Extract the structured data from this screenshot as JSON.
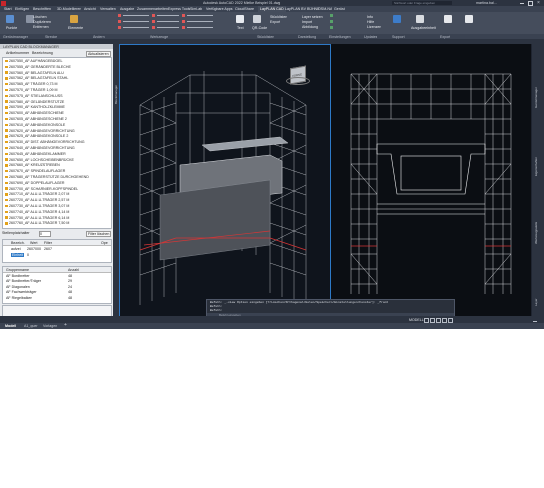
{
  "titlebar": {
    "title": "Autodesk AutoCAD 2022   Mielke Beispiel 01.dwg",
    "search_placeholder": "Stichwort oder Frage eingeben",
    "user": "martina.bal..."
  },
  "menubar": {
    "items": [
      "Start",
      "Einfügen",
      "Beschriften",
      "3D-Modellieren",
      "Ansicht",
      "Verwalten",
      "Ausgabe",
      "Zusammenarbeiten",
      "Express Tools",
      "SimLab",
      "Verfügbare Apps",
      "CloudShare",
      "LayPLAN CAD",
      "LayPLAN BV BÜHNE",
      "OSM-NA",
      "Gerüst"
    ]
  },
  "ribbon": {
    "buttons": [
      "Punkte",
      "Löschen",
      "Duplizieren",
      "Entfernen",
      "Elemente",
      "Text",
      "QR-Code",
      "Stücklisten",
      "Export",
      "Layer setzen",
      "Import",
      "Abbildung",
      "Info",
      "Hilfe",
      "Lizenzen",
      "Ausgabeeinheit"
    ],
    "panel_labels": [
      "Gerüstmanager",
      "Strecke",
      "Ändern",
      "Werkzeuge",
      "Stücklisten",
      "Darstellung",
      "Einstellungen",
      "Updates",
      "Support",
      "Export"
    ]
  },
  "doctabs": [
    "Start",
    "Mielke Beispiel 01*"
  ],
  "panel": {
    "title": "LAYPLAN CAD BLOCKMANAGER",
    "toolbar": [
      "Artikelnummer",
      "Bezeichnung",
      "Aktualisieren"
    ],
    "tree_items": [
      "2607550_AF AUFHÄNGEBÜGEL",
      "2607555_AF GERÄNDERTE BLECHE",
      "2607560_AF BELAGTAFELN ALU",
      "2607562_AF BELAGTAFELN STAHL",
      "2607565_AF TRÄGER 0,73 M",
      "2607570_AF TRÄGER 1,09 M",
      "2607575_AF STIELANSCHLUSS",
      "2607580_AF GELÄNDERSTÜTZE",
      "2607590_AF KANTHOLZKLEMME",
      "2607600_AF ABHÄNGESCHIENE",
      "2607605_AF ABHÄNGESCHIENE 2",
      "2607610_AF ABHÄNGEKONSOLE",
      "2607620_AF ABHÄNGEVORRICHTUNG",
      "2607625_AF ABHÄNGEKONSOLE 2",
      "2607630_AF DIST. ABHÄNGEVORRICHTUNG",
      "2607640_AF ABHÄNGEVORRICHTUNG",
      "2607645_AF ABHÄNGEKLAMMER",
      "2607650_AF LOCHSCHEIBENBRÜCKE",
      "2607660_AF KREUZSTREBEN",
      "2607670_AF SPINDELAUFLAGER",
      "2607680_AF TRÄGERSTÜTZE DURCHGEHEND",
      "2607690_AF DOPPELAUFLAGER",
      "2607700_AF SCHARNIER-KOPFSPINDEL",
      "2607710_AF ALU-U-TRÄGER 2,07 M",
      "2607720_AF ALU-U-TRÄGER 2,57 M",
      "2607730_AF ALU-U-TRÄGER 3,07 M",
      "2607740_AF ALU-U-TRÄGER 4,14 M",
      "2607750_AF ALU-U-TRÄGER 6,14 M",
      "2607760_AF ALU-U-TRÄGER 7,50 M"
    ],
    "filter_label": "Stellenplatzhalter",
    "filter_value": "0",
    "filter_button": "Filter löschen",
    "table1_headers": [
      "Bezeich.",
      "Wert",
      "Filter",
      "Ope"
    ],
    "table1_rows": [
      [
        "aufzei",
        "2607000",
        "2607",
        ""
      ],
      [
        "Einheit",
        "0",
        "",
        ""
      ]
    ],
    "table2_headers": [
      "Gruppenname",
      "Anzahl"
    ],
    "table2_rows": [
      [
        "AF Bordbretter",
        "48"
      ],
      [
        "AF Bordbretter/Träger",
        "29"
      ],
      [
        "AF Diagonalen",
        "24"
      ],
      [
        "AF Fachwerkträger",
        "48"
      ],
      [
        "AF Riegelbalken",
        "48"
      ]
    ]
  },
  "cmd": {
    "lines": [
      "Befehl: _-view Option eingeben [?/Löschen/Orthogonal/Holen/Speichern/Einstellungen/Fenster]: _front",
      "Befehl:",
      "Befehl:"
    ],
    "placeholder": "Befehl eingeben"
  },
  "status": {
    "model_label": "MODELL",
    "tabs": [
      "Modell",
      "A1_quer",
      "Vorlagen"
    ]
  },
  "right_strip": [
    "Gerüstmanager",
    "Eigenschaften",
    "Werkzeugpalette",
    "Layer"
  ],
  "left_strip": [
    "Blockmanager"
  ],
  "viewcube_label": "VORNE",
  "colors": {
    "ribbon": "#454d5c",
    "viewport_bg": "#0f141c",
    "accent": "#2d79c7",
    "red_lines": "#d63636"
  }
}
